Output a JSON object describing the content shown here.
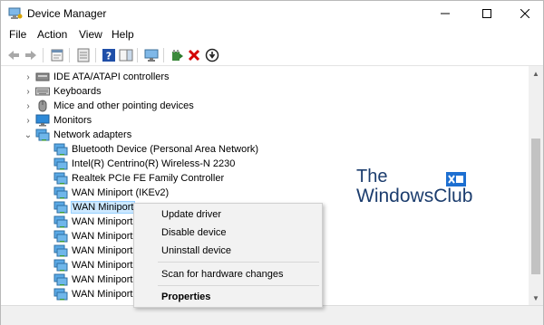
{
  "window": {
    "title": "Device Manager"
  },
  "menubar": {
    "items": [
      "File",
      "Action",
      "View",
      "Help"
    ]
  },
  "toolbar": {
    "buttons": [
      "back-icon",
      "forward-icon",
      "properties-icon",
      "show-hidden-icon",
      "help-icon",
      "action-pane-icon",
      "monitor-icon",
      "update-driver-icon",
      "uninstall-icon",
      "scan-changes-icon"
    ]
  },
  "tree": {
    "categories": [
      {
        "label": "IDE ATA/ATAPI controllers",
        "expanded": false,
        "icon": "ide-controller-icon"
      },
      {
        "label": "Keyboards",
        "expanded": false,
        "icon": "keyboard-icon"
      },
      {
        "label": "Mice and other pointing devices",
        "expanded": false,
        "icon": "mouse-icon"
      },
      {
        "label": "Monitors",
        "expanded": false,
        "icon": "monitor-icon"
      },
      {
        "label": "Network adapters",
        "expanded": true,
        "icon": "network-adapter-icon"
      }
    ],
    "network_adapters": [
      {
        "label": "Bluetooth Device (Personal Area Network)",
        "selected": false
      },
      {
        "label": "Intel(R) Centrino(R) Wireless-N 2230",
        "selected": false
      },
      {
        "label": "Realtek PCIe FE Family Controller",
        "selected": false
      },
      {
        "label": "WAN Miniport (IKEv2)",
        "selected": false
      },
      {
        "label": "WAN Miniport",
        "selected": true
      },
      {
        "label": "WAN Miniport",
        "selected": false
      },
      {
        "label": "WAN Miniport",
        "selected": false
      },
      {
        "label": "WAN Miniport",
        "selected": false
      },
      {
        "label": "WAN Miniport",
        "selected": false
      },
      {
        "label": "WAN Miniport",
        "selected": false
      },
      {
        "label": "WAN Miniport",
        "selected": false
      }
    ]
  },
  "watermark": {
    "line1": "The",
    "line2": "WindowsClub"
  },
  "context_menu": {
    "items": [
      {
        "label": "Update driver",
        "bold": false
      },
      {
        "label": "Disable device",
        "bold": false
      },
      {
        "label": "Uninstall device",
        "bold": false
      },
      {
        "label": "Scan for hardware changes",
        "bold": false
      },
      {
        "label": "Properties",
        "bold": true
      }
    ]
  },
  "colors": {
    "selection": "#cce8ff",
    "selection_border": "#99d1ff",
    "delete_red": "#d40000",
    "help_blue": "#1f4fa8",
    "watermark_blue": "#1c3d6e"
  }
}
